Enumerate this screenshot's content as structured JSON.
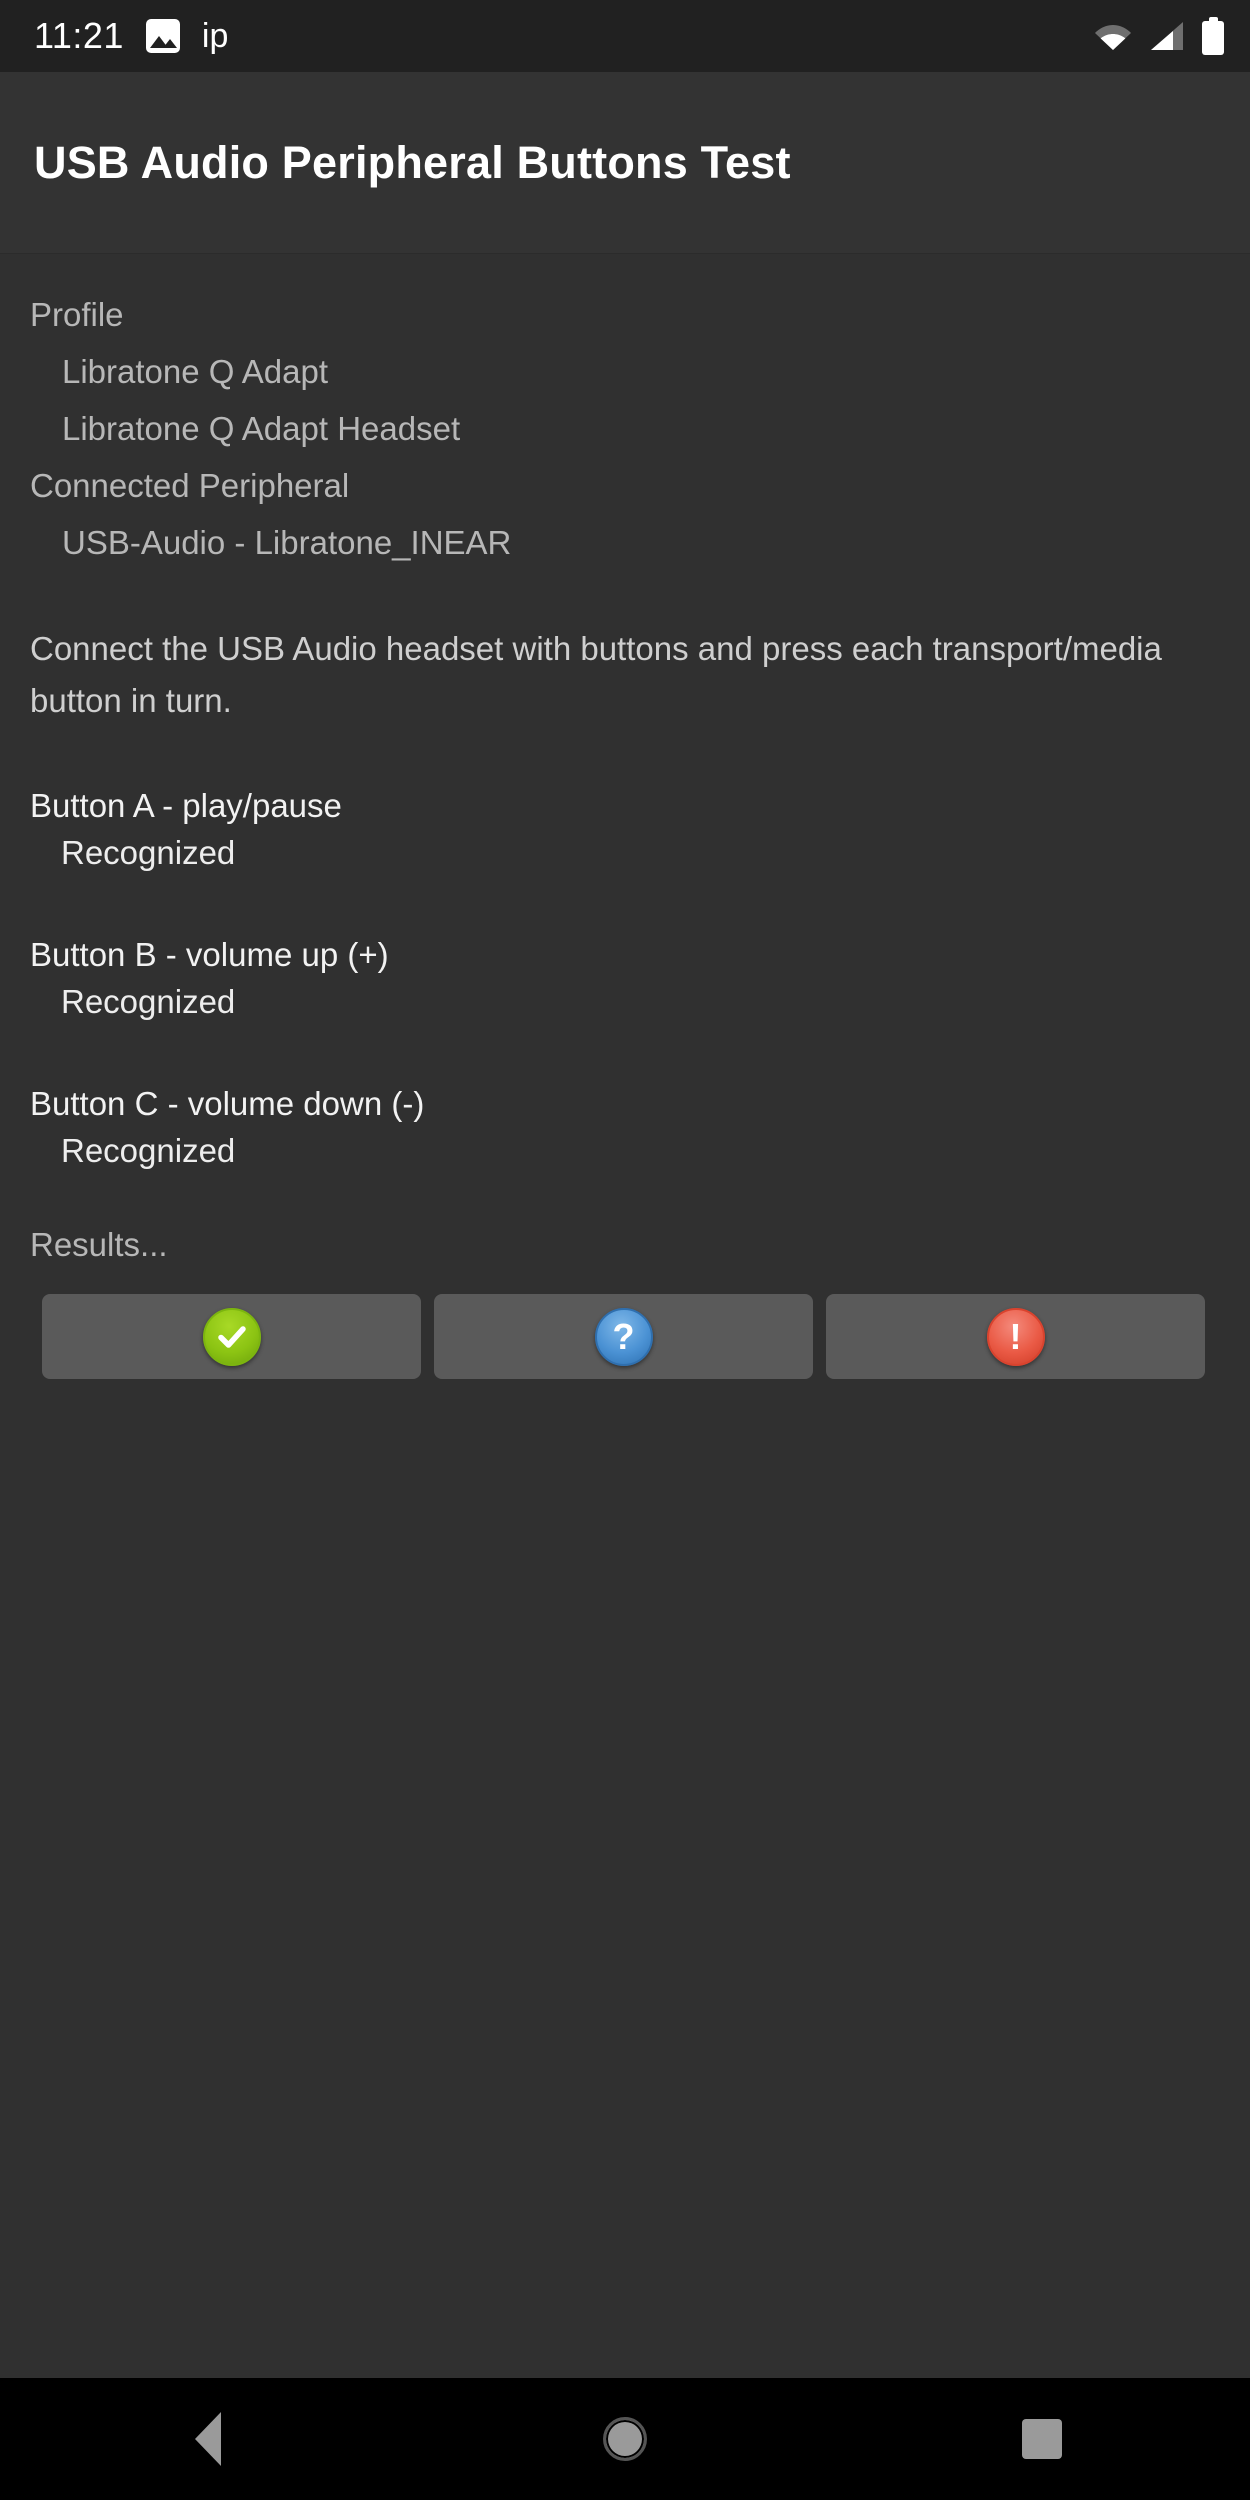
{
  "statusbar": {
    "clock": "11:21",
    "photo_icon": "photo-icon",
    "tag": "ip",
    "wifi_icon": "wifi-icon",
    "signal_icon": "cellular-signal-icon",
    "battery_icon": "battery-full-icon"
  },
  "header": {
    "title": "USB Audio Peripheral Buttons Test"
  },
  "main": {
    "profile_label": "Profile",
    "profile_values": [
      "Libratone Q Adapt",
      "Libratone Q Adapt Headset"
    ],
    "connected_label": "Connected Peripheral",
    "connected_values": [
      "USB-Audio - Libratone_INEAR"
    ],
    "instructions": "Connect the USB Audio headset with buttons and press each transport/media button in turn.",
    "buttons": [
      {
        "label": "Button A - play/pause",
        "status": "Recognized"
      },
      {
        "label": "Button B - volume up (+)",
        "status": "Recognized"
      },
      {
        "label": "Button C - volume down (-)",
        "status": "Recognized"
      }
    ],
    "results_label": "Results..."
  },
  "results_actions": [
    {
      "name": "pass-button",
      "icon": "check-circle-icon",
      "color": "#8cc413"
    },
    {
      "name": "info-button",
      "icon": "question-circle-icon",
      "color": "#4b92d4"
    },
    {
      "name": "fail-button",
      "icon": "exclamation-circle-icon",
      "color": "#ea5a45"
    }
  ],
  "navbar": {
    "back": "back-icon",
    "home": "home-icon",
    "recents": "recents-icon"
  }
}
